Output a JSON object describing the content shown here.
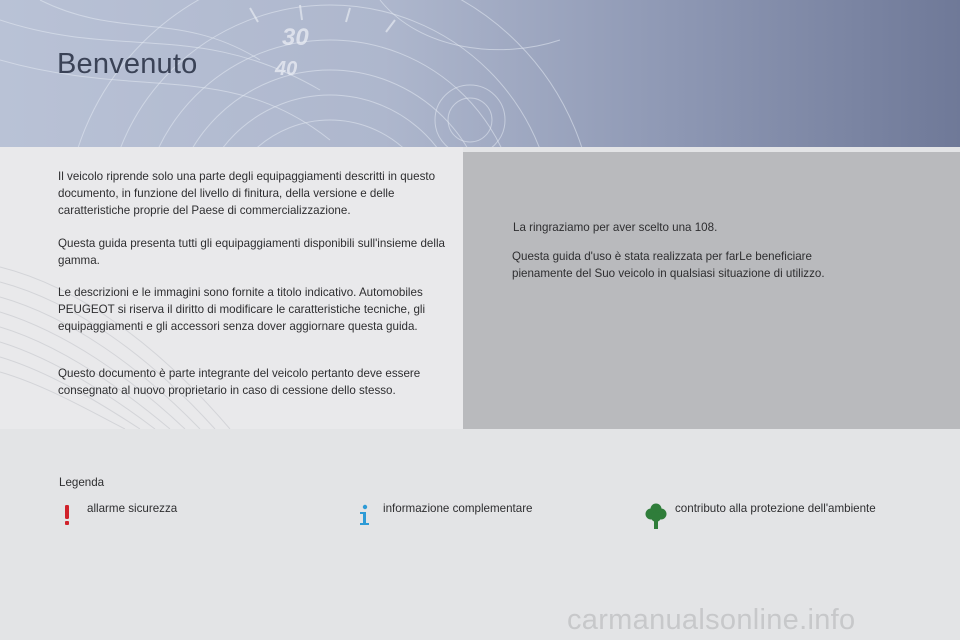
{
  "page": {
    "title": "Benvenuto"
  },
  "left_paragraphs": [
    "Il veicolo riprende solo una parte degli equipaggiamenti descritti in questo documento, in funzione del livello di finitura, della versione e delle caratteristiche proprie del Paese di commercializzazione.",
    "Questa guida presenta tutti gli equipaggiamenti disponibili sull'insieme della gamma.",
    "Le descrizioni e le immagini sono fornite a titolo indicativo. Automobiles PEUGEOT si riserva il diritto di modificare le caratteristiche tecniche, gli equipaggiamenti e gli accessori senza dover aggiornare questa guida.",
    "Questo documento è parte integrante del veicolo pertanto deve essere consegnato al nuovo proprietario in caso di cessione dello stesso."
  ],
  "right_paragraphs": [
    "La ringraziamo per aver scelto una 108.",
    "Questa guida d'uso è stata realizzata per farLe beneficiare pienamente del Suo veicolo in qualsiasi situazione di utilizzo."
  ],
  "legend": {
    "title": "Legenda",
    "items": [
      {
        "icon": "exclamation-warning-icon",
        "color": "#d0222b",
        "label": "allarme sicurezza"
      },
      {
        "icon": "info-icon",
        "color": "#2e9bd6",
        "label": "informazione complementare"
      },
      {
        "icon": "tree-icon",
        "color": "#2f7d3a",
        "label": "contributo alla protezione dell'ambiente"
      }
    ]
  },
  "header_graphic_numbers": [
    "30",
    "40"
  ],
  "watermark": "carmanualsonline.info"
}
